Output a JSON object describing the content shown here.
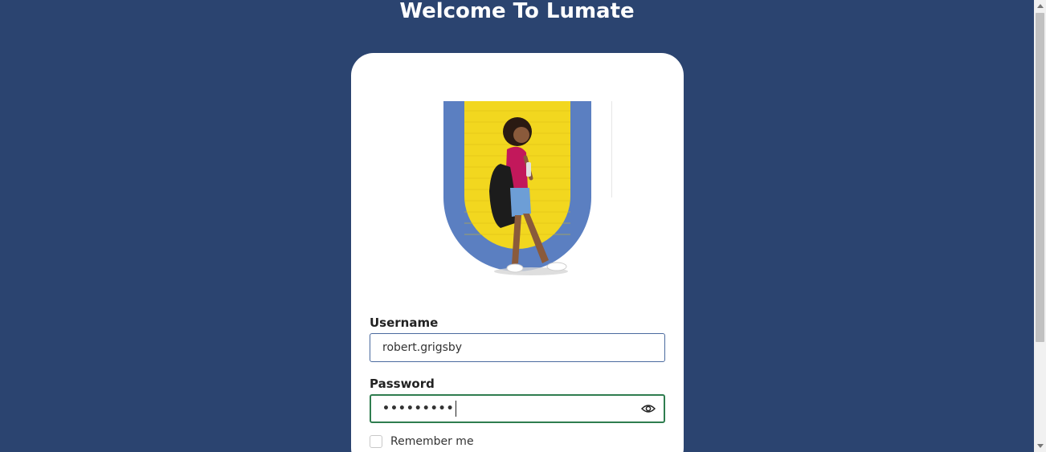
{
  "page": {
    "title": "Welcome To Lumate"
  },
  "form": {
    "username_label": "Username",
    "username_value": "robert.grigsby",
    "password_label": "Password",
    "password_masked": "•••••••••",
    "remember_label": "Remember me",
    "remember_checked": false
  },
  "icons": {
    "toggle_password": "eye-icon"
  },
  "colors": {
    "background": "#2b4470",
    "card": "#ffffff",
    "username_border": "#4a6a9e",
    "password_focus_border": "#2f7d4f",
    "hero_frame": "#5b7fc1",
    "hero_wall": "#f2d71f"
  }
}
